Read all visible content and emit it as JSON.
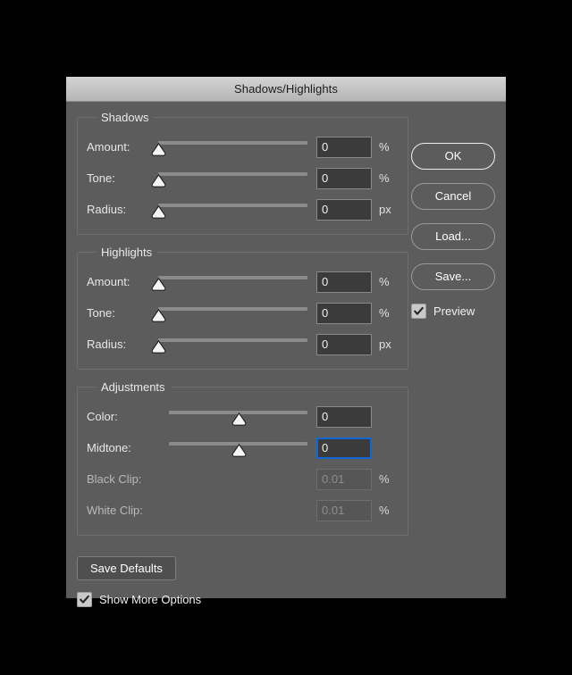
{
  "window": {
    "title": "Shadows/Highlights"
  },
  "groups": [
    {
      "legend": "Shadows",
      "rows": [
        {
          "label": "Amount:",
          "value": "0",
          "unit": "%",
          "thumb_pct": 0,
          "slider": "wide"
        },
        {
          "label": "Tone:",
          "value": "0",
          "unit": "%",
          "thumb_pct": 0,
          "slider": "wide"
        },
        {
          "label": "Radius:",
          "value": "0",
          "unit": "px",
          "thumb_pct": 0,
          "slider": "wide"
        }
      ]
    },
    {
      "legend": "Highlights",
      "rows": [
        {
          "label": "Amount:",
          "value": "0",
          "unit": "%",
          "thumb_pct": 0,
          "slider": "wide"
        },
        {
          "label": "Tone:",
          "value": "0",
          "unit": "%",
          "thumb_pct": 0,
          "slider": "wide"
        },
        {
          "label": "Radius:",
          "value": "0",
          "unit": "px",
          "thumb_pct": 0,
          "slider": "wide"
        }
      ]
    },
    {
      "legend": "Adjustments",
      "rows": [
        {
          "label": "Color:",
          "value": "0",
          "unit": "",
          "thumb_pct": 50,
          "slider": "narrow"
        },
        {
          "label": "Midtone:",
          "value": "0",
          "unit": "",
          "thumb_pct": 50,
          "slider": "narrow",
          "focused": true
        },
        {
          "label": "Black Clip:",
          "value": "0.01",
          "unit": "%",
          "slider": "none",
          "disabled": true
        },
        {
          "label": "White Clip:",
          "value": "0.01",
          "unit": "%",
          "slider": "none",
          "disabled": true
        }
      ]
    }
  ],
  "buttons": {
    "ok": "OK",
    "cancel": "Cancel",
    "load": "Load...",
    "save": "Save...",
    "save_defaults": "Save Defaults"
  },
  "checkboxes": {
    "preview": {
      "label": "Preview",
      "checked": true
    },
    "show_more_options": {
      "label": "Show More Options",
      "checked": true
    }
  },
  "colors": {
    "dialog_background": "#5c5c5c",
    "titlebar_top": "#d4d4d4",
    "titlebar_bottom": "#b4b4b4",
    "field_background": "#3b3b3b",
    "focus_border": "#1266d4",
    "slider_track": "#8b8b8b",
    "thumb_fill": "#f5f5f5",
    "text": "#f0f0f0",
    "screen_background": "#000000"
  },
  "icons": {
    "slider_thumb": "slider-thumb-icon",
    "checkmark": "checkmark-icon"
  }
}
